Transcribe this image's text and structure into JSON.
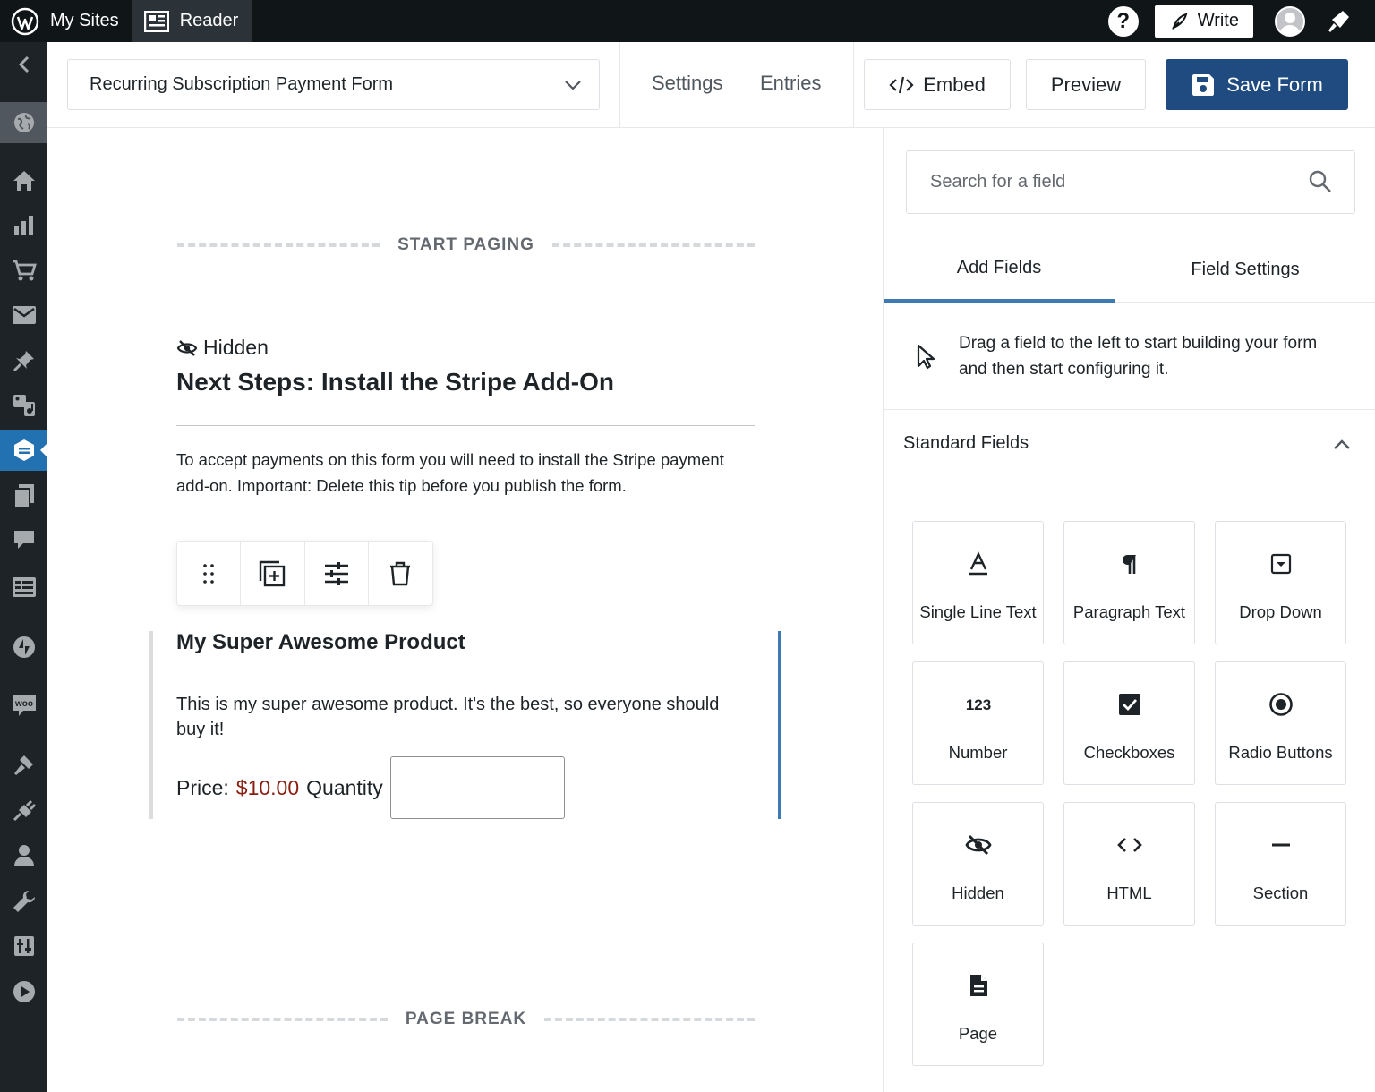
{
  "adminbar": {
    "my_sites": "My Sites",
    "reader": "Reader",
    "help": "?",
    "write": "Write"
  },
  "sidebar": {
    "icons": [
      "back-arrow-icon",
      "globe-icon",
      "home-icon",
      "stats-icon",
      "cart-icon",
      "mail-icon",
      "pin-icon",
      "media-icon",
      "forms-icon",
      "pages-icon",
      "comments-icon",
      "feedback-icon",
      "jetpack-icon",
      "woo-icon",
      "appearance-icon",
      "plugins-icon",
      "users-icon",
      "tools-icon",
      "settings-icon",
      "play-icon"
    ],
    "active": "forms-icon",
    "woo_text": "woo"
  },
  "toolbar": {
    "form_name": "Recurring Subscription Payment Form",
    "settings": "Settings",
    "entries": "Entries",
    "embed": "Embed",
    "preview": "Preview",
    "save": "Save Form"
  },
  "canvas": {
    "start_paging": "START PAGING",
    "hidden_label": "Hidden",
    "field_title": "Next Steps: Install the Stripe Add-On",
    "field_desc": "To accept payments on this form you will need to install the Stripe payment add-on. Important: Delete this tip before you publish the form.",
    "product_title": "My Super Awesome Product",
    "product_desc": "This is my super awesome product. It's the best, so everyone should buy it!",
    "price_label": "Price:",
    "price_value": "$10.00",
    "quantity_label": "Quantity",
    "quantity_value": "",
    "page_break": "PAGE BREAK"
  },
  "panel": {
    "search_placeholder": "Search for a field",
    "tab_add": "Add Fields",
    "tab_settings": "Field Settings",
    "drag_hint": "Drag a field to the left to start building your form and then start configuring it.",
    "standard_fields": "Standard Fields",
    "fields": [
      {
        "label": "Single Line Text",
        "icon": "text-icon"
      },
      {
        "label": "Paragraph Text",
        "icon": "paragraph-icon"
      },
      {
        "label": "Drop Down",
        "icon": "dropdown-icon"
      },
      {
        "label": "Number",
        "icon": "number-icon",
        "glyph": "123"
      },
      {
        "label": "Checkboxes",
        "icon": "checkbox-icon"
      },
      {
        "label": "Radio Buttons",
        "icon": "radio-icon"
      },
      {
        "label": "Hidden",
        "icon": "hidden-icon"
      },
      {
        "label": "HTML",
        "icon": "html-icon"
      },
      {
        "label": "Section",
        "icon": "section-icon"
      },
      {
        "label": "Page",
        "icon": "page-icon"
      }
    ]
  },
  "colors": {
    "adminbar": "#101517",
    "sidebar": "#1d2327",
    "accent": "#2271b1",
    "save_button": "#204b80",
    "price": "#8a1f11"
  }
}
